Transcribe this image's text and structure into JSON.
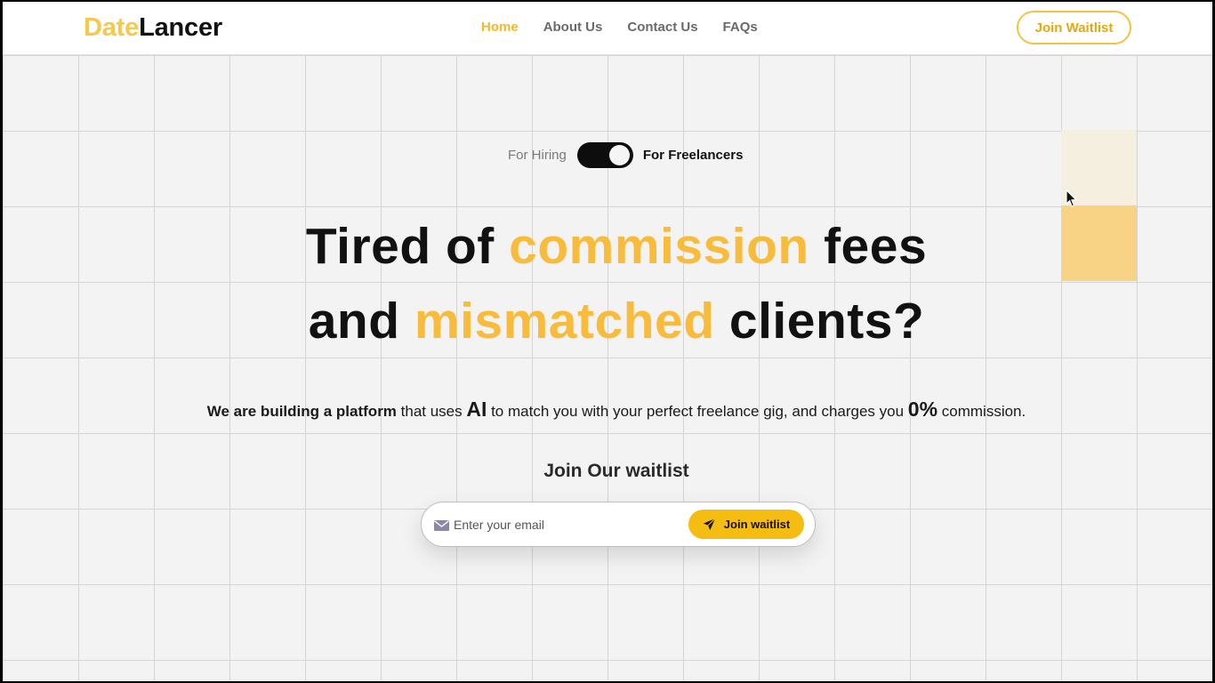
{
  "brand": {
    "part1": "Date",
    "part2": "Lancer",
    "accent_color": "#f6c94a"
  },
  "nav": {
    "links": [
      {
        "label": "Home",
        "active": true
      },
      {
        "label": "About Us",
        "active": false
      },
      {
        "label": "Contact Us",
        "active": false
      },
      {
        "label": "FAQs",
        "active": false
      }
    ],
    "cta_label": "Join Waitlist"
  },
  "toggle": {
    "left_label": "For Hiring",
    "right_label": "For Freelancers",
    "selected": "For Freelancers"
  },
  "hero": {
    "line1_pre": "Tired of ",
    "line1_highlight": "commission",
    "line1_post": " fees",
    "line2_pre": "and ",
    "line2_highlight": "mismatched",
    "line2_post": " clients?"
  },
  "subtitle": {
    "part1": "We are building a platform",
    "part2": " that uses ",
    "part3": "AI",
    "part4": " to match you with your perfect freelance gig, and charges you ",
    "part5": "0%",
    "part6": " commission."
  },
  "waitlist": {
    "heading": "Join Our waitlist",
    "email_placeholder": "Enter your email",
    "email_value": "",
    "button_label": "Join waitlist"
  },
  "icons": {
    "mail": "mail-icon",
    "send": "paper-plane-icon",
    "cursor": "mouse-pointer-icon"
  },
  "colors": {
    "highlight": "#f8bb3c",
    "button": "#f5bd12",
    "grid_cell_light": "#f5efdf",
    "grid_cell_dark": "#f8d385"
  }
}
